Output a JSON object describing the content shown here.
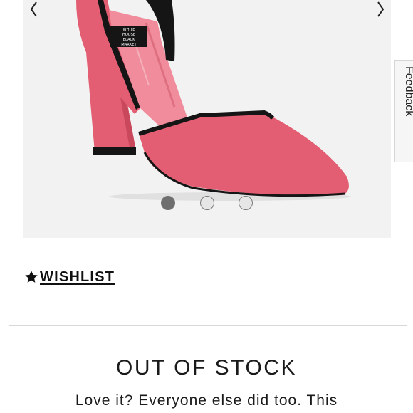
{
  "gallery": {
    "image_label": "Pink suede pointed-toe d'Orsay block heel pump with black trim",
    "brand_tag_lines": [
      "WHITE",
      "HOUSE",
      "BLACK",
      "MARKET"
    ],
    "prev_icon": "chevron-left-icon",
    "next_icon": "chevron-right-icon",
    "dots": {
      "count": 3,
      "active_index": 0
    },
    "colors": {
      "background": "#f2f2f2",
      "suede": "#e35e73",
      "lining": "#f08c9b",
      "trim": "#151515"
    }
  },
  "feedback": {
    "label": "Feedback"
  },
  "wishlist": {
    "icon": "star-icon",
    "label": "WISHLIST"
  },
  "stock": {
    "status": "OUT OF STOCK",
    "message": "Love it? Everyone else did too. This"
  }
}
